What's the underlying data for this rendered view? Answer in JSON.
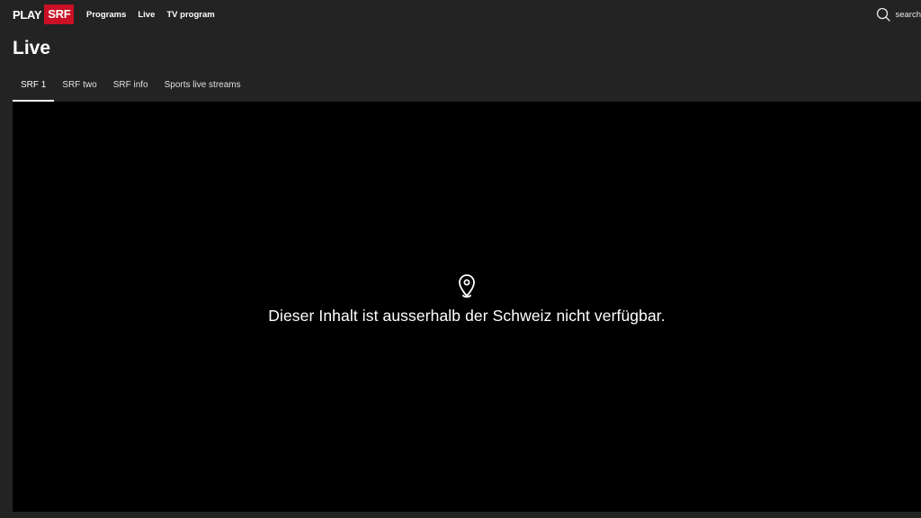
{
  "header": {
    "logo_play": "PLAY",
    "logo_srf": "SRF",
    "nav": [
      {
        "label": "Programs"
      },
      {
        "label": "Live"
      },
      {
        "label": "TV program"
      }
    ],
    "search_label": "search"
  },
  "page": {
    "title": "Live"
  },
  "tabs": [
    {
      "label": "SRF 1",
      "active": true
    },
    {
      "label": "SRF two",
      "active": false
    },
    {
      "label": "SRF info",
      "active": false
    },
    {
      "label": "Sports live streams",
      "active": false
    }
  ],
  "player": {
    "icon": "location-pin-icon",
    "message": "Dieser Inhalt ist ausserhalb der Schweiz nicht verfügbar."
  },
  "colors": {
    "background": "#232323",
    "player_background": "#000000",
    "brand_red": "#c91024",
    "text": "#ffffff"
  }
}
